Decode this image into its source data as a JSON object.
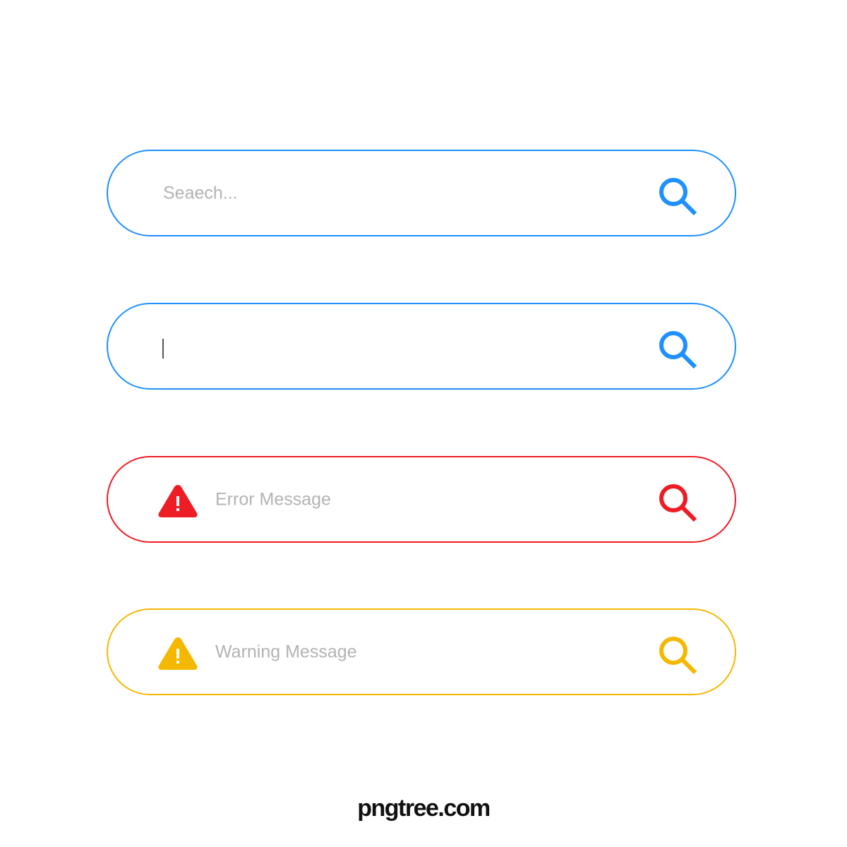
{
  "search_bars": [
    {
      "state": "default",
      "placeholder": "Seaech...",
      "color": "#1e90ff",
      "search_icon": "search-icon"
    },
    {
      "state": "focused",
      "value": "",
      "color": "#1e90ff",
      "search_icon": "search-icon"
    },
    {
      "state": "error",
      "message": "Error Message",
      "color": "#ee1c24",
      "status_icon": "warning-triangle-icon",
      "search_icon": "search-icon"
    },
    {
      "state": "warning",
      "message": "Warning Message",
      "color": "#f5b800",
      "status_icon": "warning-triangle-icon",
      "search_icon": "search-icon"
    }
  ],
  "placeholder_color": "#b3b3b3",
  "watermark": "pngtree.com"
}
